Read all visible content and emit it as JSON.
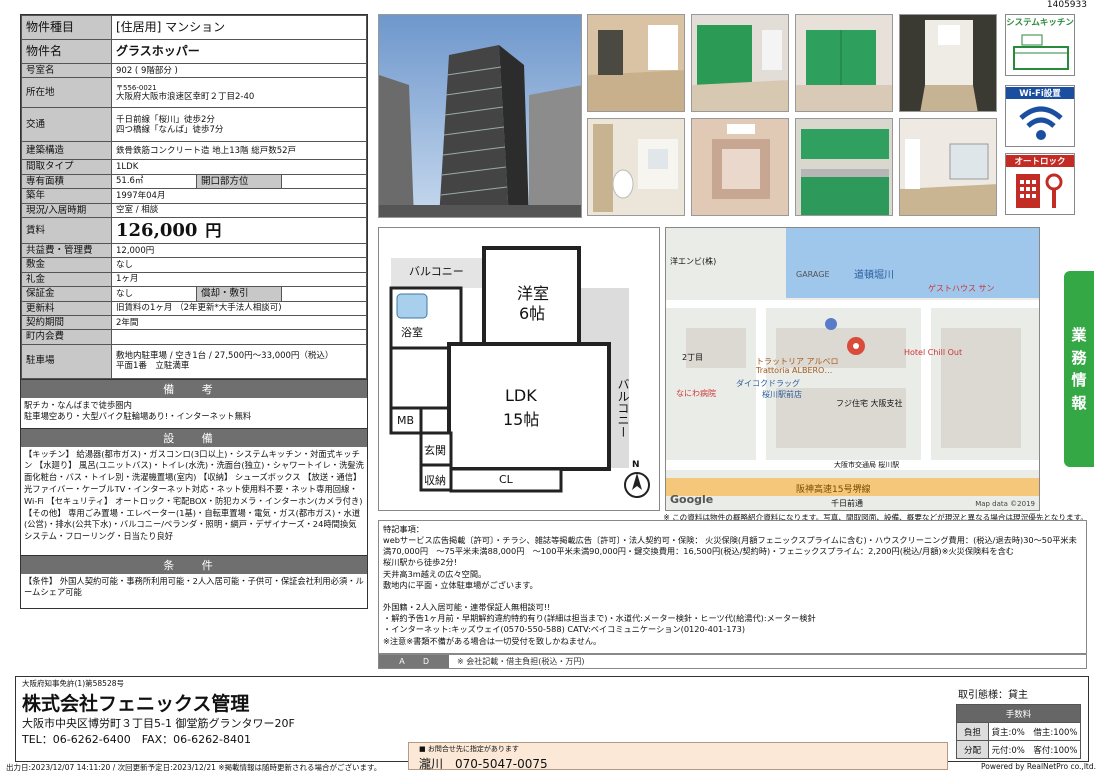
{
  "doc_id": "1405933",
  "property": {
    "type_label": "物件種目",
    "type_value": "[住居用] マンション",
    "name_label": "物件名",
    "name_value": "グラスホッパー",
    "room_label": "号室名",
    "room_value": "902 ( 9階部分 )",
    "address_label": "所在地",
    "postal": "〒556-0021",
    "address": "大阪府大阪市浪速区幸町２丁目2-40",
    "transit_label": "交通",
    "transit_1": "千日前線「桜川」徒歩2分",
    "transit_2": "四つ橋線「なんば」徒歩7分",
    "structure_label": "建築構造",
    "structure_value": "鉄骨鉄筋コンクリート造 地上13階 総戸数52戸",
    "layout_label": "間取タイプ",
    "layout_value": "1LDK",
    "area_label": "専有面積",
    "area_value": "51.6㎡",
    "direction_label": "開口部方位",
    "direction_value": "",
    "built_label": "築年",
    "built_value": "1997年04月",
    "status_label": "現況/入居時期",
    "status_value": "空室 / 相談",
    "rent_label": "賃料",
    "rent_value": "126,000",
    "rent_unit": "円",
    "mgmt_label": "共益費・管理費",
    "mgmt_value": "12,000円",
    "deposit_label": "敷金",
    "deposit_value": "なし",
    "keymoney_label": "礼金",
    "keymoney_value": "1ヶ月",
    "guarantee_label": "保証金",
    "guarantee_value": "なし",
    "amort_label": "償却・敷引",
    "amort_value": "",
    "renewal_label": "更新料",
    "renewal_value": "旧賃料の1ヶ月 （2年更新*大手法人相談可)",
    "term_label": "契約期間",
    "term_value": "2年間",
    "town_fee_label": "町内会費",
    "town_fee_value": "",
    "parking_label": "駐車場",
    "parking_1": "敷地内駐車場 / 空き1台 / 27,500円～33,000円（税込）",
    "parking_2": "平面1番　立駐満車"
  },
  "remarks": {
    "title": "備 考",
    "text": "駅チカ・なんばまで徒歩圏内\n駐車場空あり・大型バイク駐輪場あり!・インターネット無料"
  },
  "equipment": {
    "title": "設 備",
    "text": "【キッチン】 給湯器(都市ガス)・ガスコンロ(3口以上)・システムキッチン・対面式キッチン 【水廻り】 風呂(ユニットバス)・トイレ(水洗)・洗面台(独立)・シャワートイレ・洗髪洗面化粧台・バス・トイレ別・洗濯機置場(室内) 【収納】 シューズボックス 【放送・通信】 光ファイバー・ケーブルTV・インターネット対応・ネット使用料不要・ネット専用回線・Wi-Fi 【セキュリティ】 オートロック・宅配BOX・防犯カメラ・インターホン(カメラ付き) 【その他】 専用ごみ置場・エレベーター(1基)・自転車置場・電気・ガス(都市ガス)・水道(公営)・排水(公共下水)・バルコニー/ベランダ・照明・網戸・デザイナーズ・24時間換気システム・フローリング・日当たり良好"
  },
  "conditions": {
    "title": "条 件",
    "text": "【条件】 外国人契約可能・事務所利用可能・2人入居可能・子供可・保証会社利用必須・ルームシェア可能"
  },
  "features": [
    "システムキッチン",
    "Wi-Fi設置",
    "オートロック"
  ],
  "side_tab": [
    "業",
    "務",
    "情",
    "報"
  ],
  "floorplan": {
    "balcony_top": "バルコニー",
    "western_room": "洋室",
    "western_size": "6帖",
    "bath": "浴室",
    "ldk": "LDK",
    "ldk_size": "15帖",
    "balcony_side": "バルコニー",
    "mb": "MB",
    "entrance": "玄関",
    "storage": "収納",
    "closet": "CL",
    "north": "N"
  },
  "map": {
    "labels": [
      "洋エンビ(株)",
      "GARAGE",
      "道頓堀川",
      "ゲストハウス サン",
      "Hotel Chill Out",
      "トラットリア アルベロ",
      "Trattoria ALBERO…",
      "2丁目",
      "なにわ病院",
      "ダイコクドラッグ",
      "桜川駅前店",
      "フジ住宅 大阪支社",
      "大阪市交通局 桜川駅",
      "阪神高速15号堺線",
      "千日前通"
    ],
    "google": "Google",
    "credit": "Map data ©2019"
  },
  "disclaimer": "※ この資料は物件の概略紹介資料になります。写真、間取図面、設備、概要などが現況と異なる場合は現況優先となります。",
  "notes": "特記事項：\nwebサービス広告掲載〔許可〕・チラシ、雑誌等掲載広告〔許可〕・法人契約可・保険： 火災保険(月額フェニックスプライムに含む)・ハウスクリーニング費用：(税込/退去時)30～50平米未満70,000円　～75平米未満88,000円　～100平米未満90,000円・鍵交換費用：16,500円(税込/契約時)・フェニックスプライム：2,200円(税込/月額)※火災保険料を含む\n桜川駅から徒歩2分!\n天井高3m越えの広々空間。\n敷地内に平面・立体駐車場がございます。\n\n外国籍・2人入居可能・連帯保証人無相談可!!\n・解約予告1ヶ月前・早期解約違約特約有り(詳細は担当まで)・水道代:メーター検針・ヒーツ代(給湯代):メーター検針\n・インターネット:キッズウェイ(0570-550-588) CATV:ベイコミュニケーション(0120-401-173)\n※注意※書類不備がある場合は一切受付を致しかねません。",
  "ad": {
    "label": "Ａ　　Ｄ",
    "text": "※ 会社記載・借主負担(税込・万円)"
  },
  "company": {
    "license": "大阪府知事免許(1)第58528号",
    "name": "株式会社フェニックス管理",
    "address": "大阪市中央区博労町３丁目5-1 御堂筋グランタワー20F",
    "tel": "TEL：06-6262-6400　FAX：06-6262-8401"
  },
  "contact": {
    "small": "■ お問合せ先に指定があります",
    "main": "瀧川　070-5047-0075"
  },
  "trade": {
    "title": "取引態様：貸主",
    "fee_title": "手数料",
    "row1_label": "負担",
    "row1_value": "貸主:0%　借主:100%",
    "row2_label": "分配",
    "row2_value": "元付:0%　客付:100%"
  },
  "footer": {
    "left": "出力日:2023/12/07 14:11:20 / 次回更新予定日:2023/12/21 ※掲載情報は随時更新される場合がございます。",
    "right": "Powered by RealNetPro co.,ltd."
  }
}
